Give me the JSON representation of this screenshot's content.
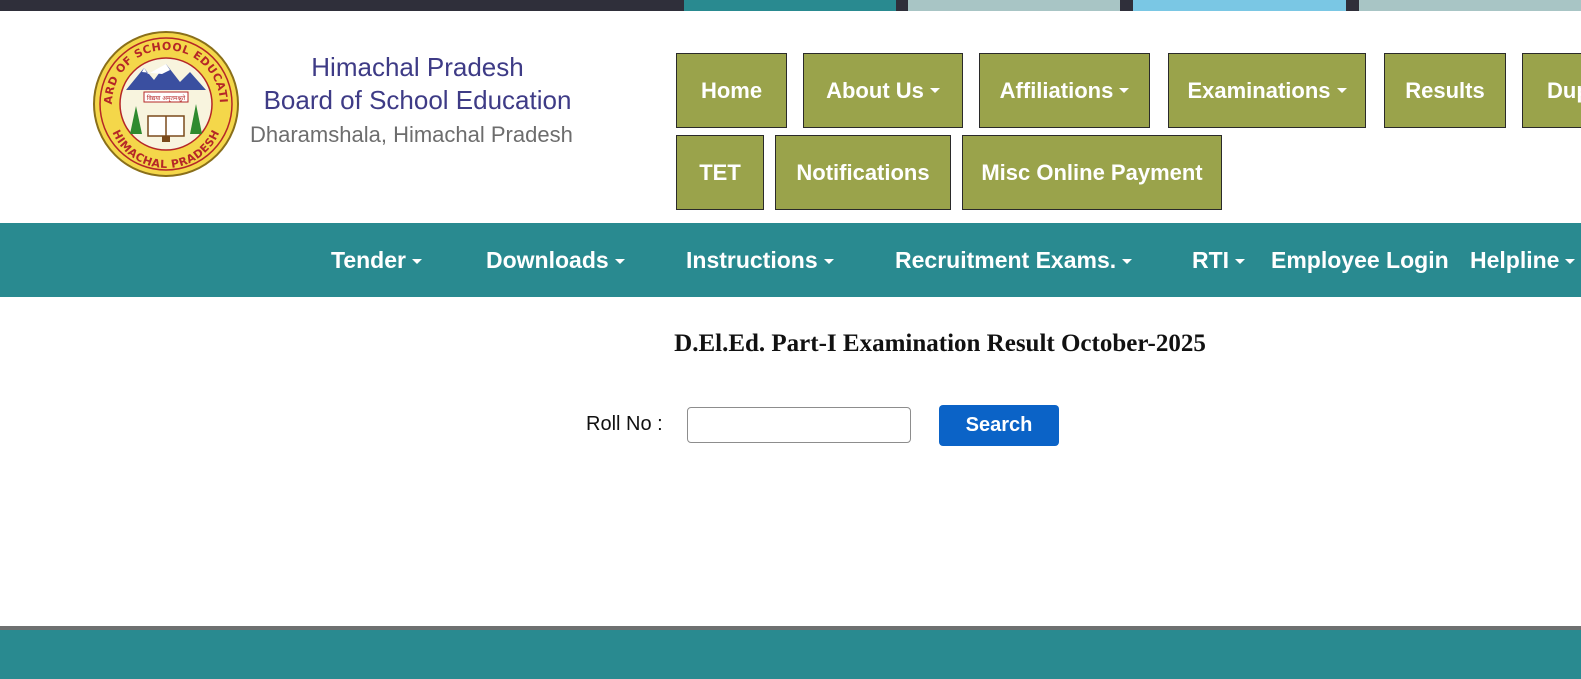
{
  "colors": {
    "nav_button": "#9aa34b",
    "teal_bar": "#298a90",
    "brand_text": "#3e3b86",
    "search_button": "#0b63c7",
    "top_strip": [
      "#2f2f3a",
      "#298a90",
      "#a8c5c5",
      "#7ac7e4",
      "#a8c5c5"
    ]
  },
  "logo": {
    "ring_top_text": "BOARD OF SCHOOL EDUCATION",
    "ring_bottom_text": "HIMACHAL PRADESH",
    "banner_text": "विद्यया अमृतमश्नुते",
    "icon": "board-emblem-icon"
  },
  "brand": {
    "line1": "Himachal Pradesh",
    "line2": "Board of School Education",
    "line3": "Dharamshala, Himachal Pradesh"
  },
  "nav": {
    "row1": [
      "Home",
      "About Us",
      "Affiliations",
      "Examinations",
      "Results",
      "Dup"
    ],
    "row2": [
      "TET",
      "Notifications",
      "Misc Online Payment"
    ]
  },
  "teal_menu": [
    "Tender",
    "Downloads",
    "Instructions",
    "Recruitment Exams.",
    "RTI",
    "Employee Login",
    "Helpline"
  ],
  "main": {
    "title": "D.El.Ed. Part-I Examination Result October-2025",
    "roll_label": "Roll No :",
    "roll_value": "",
    "search_label": "Search"
  }
}
